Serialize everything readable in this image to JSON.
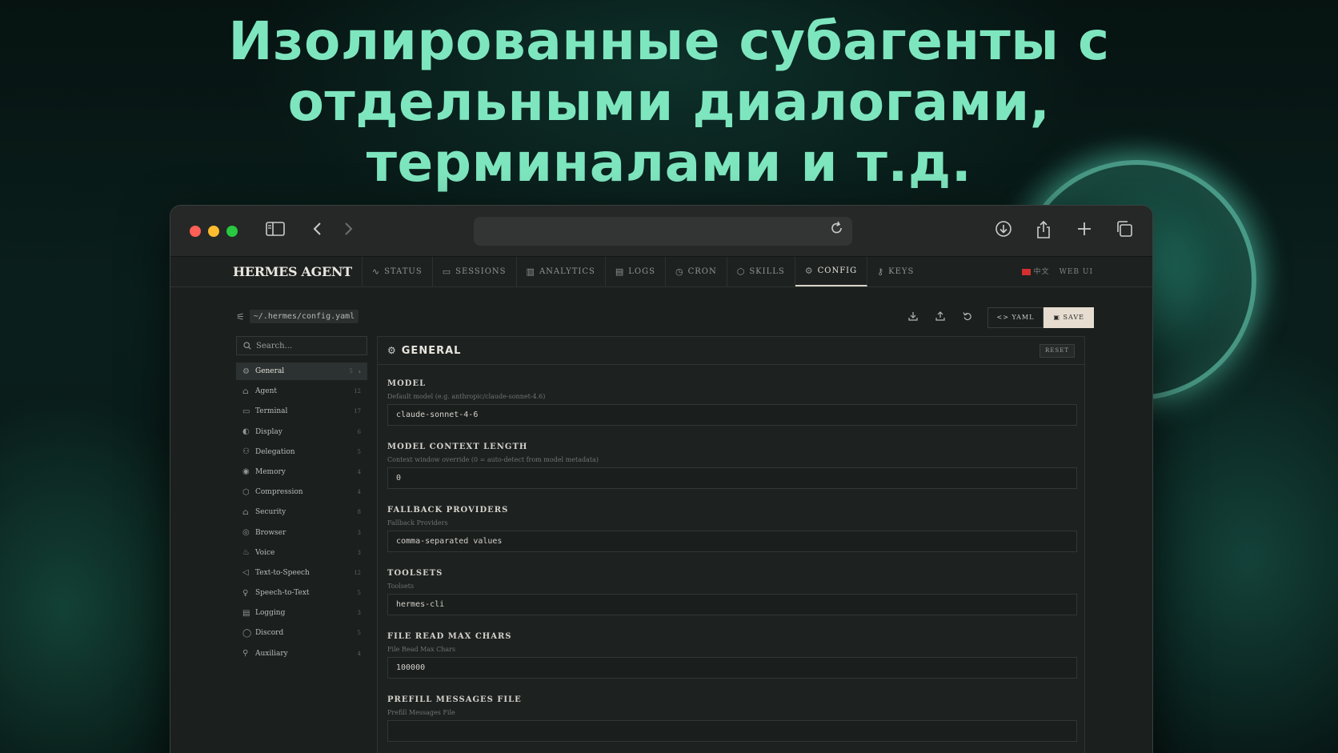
{
  "headline": {
    "line1": "Изолированные субагенты с",
    "line2": "отдельными диалогами,",
    "line3": "терминалами и т.д."
  },
  "browser": {
    "icons": [
      "sidebar-icon",
      "back-icon",
      "forward-icon",
      "reload-icon",
      "download-icon",
      "share-icon",
      "new-tab-icon",
      "tabs-overview-icon"
    ]
  },
  "nav": {
    "brand": "HERMES AGENT",
    "tabs": [
      {
        "label": "STATUS",
        "icon": "∿"
      },
      {
        "label": "SESSIONS",
        "icon": "▭"
      },
      {
        "label": "ANALYTICS",
        "icon": "▥"
      },
      {
        "label": "LOGS",
        "icon": "▤"
      },
      {
        "label": "CRON",
        "icon": "◷"
      },
      {
        "label": "SKILLS",
        "icon": "⬡"
      },
      {
        "label": "CONFIG",
        "icon": "⚙"
      },
      {
        "label": "KEYS",
        "icon": "⚷"
      }
    ],
    "active_tab": "CONFIG",
    "lang": "中文",
    "webui": "WEB UI"
  },
  "config": {
    "path": "~/.hermes/config.yaml",
    "yaml_label": "YAML",
    "save_label": "SAVE",
    "search_placeholder": "Search...",
    "sections": [
      {
        "label": "General",
        "count": "5",
        "icon": "⚙"
      },
      {
        "label": "Agent",
        "count": "12",
        "icon": "⌂"
      },
      {
        "label": "Terminal",
        "count": "17",
        "icon": "▭"
      },
      {
        "label": "Display",
        "count": "6",
        "icon": "◐"
      },
      {
        "label": "Delegation",
        "count": "5",
        "icon": "⚇"
      },
      {
        "label": "Memory",
        "count": "4",
        "icon": "◉"
      },
      {
        "label": "Compression",
        "count": "4",
        "icon": "⬡"
      },
      {
        "label": "Security",
        "count": "8",
        "icon": "⌂"
      },
      {
        "label": "Browser",
        "count": "3",
        "icon": "◎"
      },
      {
        "label": "Voice",
        "count": "3",
        "icon": "♨"
      },
      {
        "label": "Text-to-Speech",
        "count": "12",
        "icon": "◁"
      },
      {
        "label": "Speech-to-Text",
        "count": "5",
        "icon": "♀"
      },
      {
        "label": "Logging",
        "count": "3",
        "icon": "▤"
      },
      {
        "label": "Discord",
        "count": "5",
        "icon": "◯"
      },
      {
        "label": "Auxiliary",
        "count": "4",
        "icon": "⚲"
      }
    ],
    "panel_title": "GENERAL",
    "reset_label": "RESET",
    "fields": [
      {
        "label": "MODEL",
        "description": "Default model (e.g. anthropic/claude-sonnet-4.6)",
        "value": "claude-sonnet-4-6"
      },
      {
        "label": "MODEL CONTEXT LENGTH",
        "description": "Context window override (0 = auto-detect from model metadata)",
        "value": "0"
      },
      {
        "label": "FALLBACK PROVIDERS",
        "description": "Fallback Providers",
        "value": "comma-separated values"
      },
      {
        "label": "TOOLSETS",
        "description": "Toolsets",
        "value": "hermes-cli"
      },
      {
        "label": "FILE READ MAX CHARS",
        "description": "File Read Max Chars",
        "value": "100000"
      },
      {
        "label": "PREFILL MESSAGES FILE",
        "description": "Prefill Messages File",
        "value": ""
      }
    ]
  }
}
